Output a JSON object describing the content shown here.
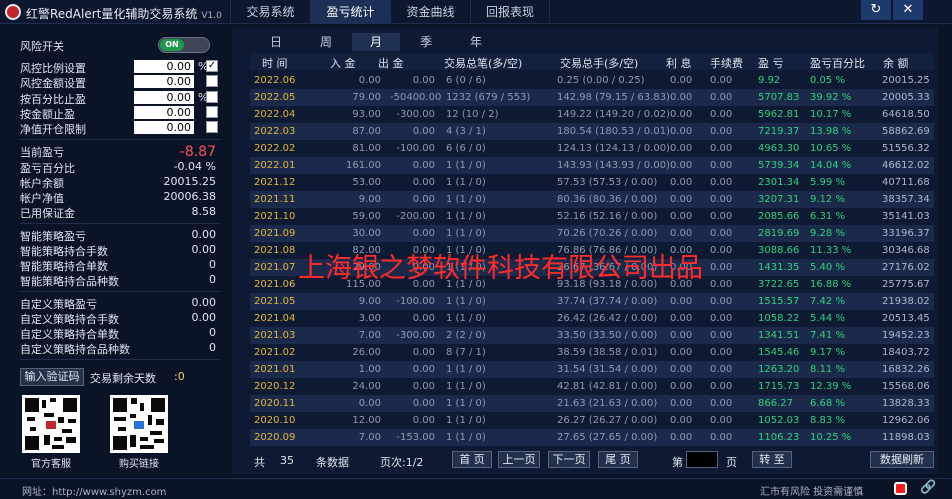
{
  "app": {
    "title": "红警RedAlert量化辅助交易系统",
    "version": "V1.0",
    "tabs": [
      "交易系统",
      "盈亏统计",
      "资金曲线",
      "回报表现"
    ],
    "active_tab": "盈亏统计",
    "refresh_icon": "refresh-icon",
    "close_icon": "close-icon",
    "refresh_glyph": "↻",
    "close_glyph": "✕"
  },
  "risk": {
    "switch_label": "风险开关",
    "switch_state": "ON",
    "settings": [
      {
        "label": "风控比例设置",
        "value": "0.00",
        "unit": "%",
        "checked": true
      },
      {
        "label": "风控金额设置",
        "value": "0.00",
        "unit": "",
        "checked": false
      },
      {
        "label": "按百分比止盈",
        "value": "0.00",
        "unit": "%",
        "checked": false
      },
      {
        "label": "按金额止盈",
        "value": "0.00",
        "unit": "",
        "checked": false
      },
      {
        "label": "净值开仓限制",
        "value": "0.00",
        "unit": "",
        "checked": false
      }
    ],
    "check_glyph": "✓"
  },
  "account": {
    "items": [
      {
        "label": "当前盈亏",
        "value": "-8.87"
      },
      {
        "label": "盈亏百分比",
        "value": "-0.04 %"
      },
      {
        "label": "帐户余额",
        "value": "20015.25"
      },
      {
        "label": "帐户净值",
        "value": "20006.38"
      },
      {
        "label": "已用保证金",
        "value": "8.58"
      }
    ]
  },
  "smart_strategy": {
    "items": [
      {
        "label": "智能策略盈亏",
        "value": "0.00"
      },
      {
        "label": "智能策略持合手数",
        "value": "0.00"
      },
      {
        "label": "智能策略持合单数",
        "value": "0"
      },
      {
        "label": "智能策略持合品种数",
        "value": "0"
      }
    ]
  },
  "custom_strategy": {
    "items": [
      {
        "label": "自定义策略盈亏",
        "value": "0.00"
      },
      {
        "label": "自定义策略持合手数",
        "value": "0.00"
      },
      {
        "label": "自定义策略持合单数",
        "value": "0"
      },
      {
        "label": "自定义策略持合品种数",
        "value": "0"
      }
    ]
  },
  "verify": {
    "button_label": "输入验证码",
    "days_left_label": "交易剩余天数",
    "days_left_value": ":0"
  },
  "qr": {
    "service_caption": "官方客服",
    "purchase_caption": "购买链接"
  },
  "periods": [
    "日",
    "周",
    "月",
    "季",
    "年"
  ],
  "active_period": "月",
  "table": {
    "headers": [
      "时 间",
      "入 金",
      "出 金",
      "交易总笔(多/空)",
      "交易总手(多/空)",
      "利 息",
      "手续费",
      "盈 亏",
      "盈亏百分比",
      "余 额"
    ],
    "rows": [
      [
        "2022.06",
        "0.00",
        "0.00",
        "6  (0 / 6)",
        "0.25  (0.00 / 0.25)",
        "0.00",
        "0.00",
        "9.92",
        "0.05 %",
        "20015.25"
      ],
      [
        "2022.05",
        "79.00",
        "-50400.00",
        "1232  (679 / 553)",
        "142.98  (79.15 / 63.83)",
        "0.00",
        "0.00",
        "5707.83",
        "39.92 %",
        "20005.33"
      ],
      [
        "2022.04",
        "93.00",
        "-300.00",
        "12  (10 / 2)",
        "149.22  (149.20 / 0.02)",
        "0.00",
        "0.00",
        "5962.81",
        "10.17 %",
        "64618.50"
      ],
      [
        "2022.03",
        "87.00",
        "0.00",
        "4  (3 / 1)",
        "180.54  (180.53 / 0.01)",
        "0.00",
        "0.00",
        "7219.37",
        "13.98 %",
        "58862.69"
      ],
      [
        "2022.02",
        "81.00",
        "-100.00",
        "6  (6 / 0)",
        "124.13  (124.13 / 0.00)",
        "0.00",
        "0.00",
        "4963.30",
        "10.65 %",
        "51556.32"
      ],
      [
        "2022.01",
        "161.00",
        "0.00",
        "1  (1 / 0)",
        "143.93  (143.93 / 0.00)",
        "0.00",
        "0.00",
        "5739.34",
        "14.04 %",
        "46612.02"
      ],
      [
        "2021.12",
        "53.00",
        "0.00",
        "1  (1 / 0)",
        "57.53  (57.53 / 0.00)",
        "0.00",
        "0.00",
        "2301.34",
        "5.99 %",
        "40711.68"
      ],
      [
        "2021.11",
        "9.00",
        "0.00",
        "1  (1 / 0)",
        "80.36  (80.36 / 0.00)",
        "0.00",
        "0.00",
        "3207.31",
        "9.12 %",
        "38357.34"
      ],
      [
        "2021.10",
        "59.00",
        "-200.00",
        "1  (1 / 0)",
        "52.16  (52.16 / 0.00)",
        "0.00",
        "0.00",
        "2085.66",
        "6.31 %",
        "35141.03"
      ],
      [
        "2021.09",
        "30.00",
        "0.00",
        "1  (1 / 0)",
        "70.26  (70.26 / 0.00)",
        "0.00",
        "0.00",
        "2819.69",
        "9.28 %",
        "33196.37"
      ],
      [
        "2021.08",
        "82.00",
        "0.00",
        "1  (1 / 0)",
        "76.86  (76.86 / 0.00)",
        "0.00",
        "0.00",
        "3088.66",
        "11.33 %",
        "30346.68"
      ],
      [
        "2021.07",
        "29.00",
        "0.00",
        "1  (1 / 0)",
        "36.67  (36.67 / 0.00)",
        "0.00",
        "0.00",
        "1431.35",
        "5.40 %",
        "27176.02"
      ],
      [
        "2021.06",
        "115.00",
        "0.00",
        "1  (1 / 0)",
        "93.18  (93.18 / 0.00)",
        "0.00",
        "0.00",
        "3722.65",
        "16.88 %",
        "25775.67"
      ],
      [
        "2021.05",
        "9.00",
        "-100.00",
        "1  (1 / 0)",
        "37.74  (37.74 / 0.00)",
        "0.00",
        "0.00",
        "1515.57",
        "7.42 %",
        "21938.02"
      ],
      [
        "2021.04",
        "3.00",
        "0.00",
        "1  (1 / 0)",
        "26.42  (26.42 / 0.00)",
        "0.00",
        "0.00",
        "1058.22",
        "5.44 %",
        "20513.45"
      ],
      [
        "2021.03",
        "7.00",
        "-300.00",
        "2  (2 / 0)",
        "33.50  (33.50 / 0.00)",
        "0.00",
        "0.00",
        "1341.51",
        "7.41 %",
        "19452.23"
      ],
      [
        "2021.02",
        "26.00",
        "0.00",
        "8  (7 / 1)",
        "38.59  (38.58 / 0.01)",
        "0.00",
        "0.00",
        "1545.46",
        "9.17 %",
        "18403.72"
      ],
      [
        "2021.01",
        "1.00",
        "0.00",
        "1  (1 / 0)",
        "31.54  (31.54 / 0.00)",
        "0.00",
        "0.00",
        "1263.20",
        "8.11 %",
        "16832.26"
      ],
      [
        "2020.12",
        "24.00",
        "0.00",
        "1  (1 / 0)",
        "42.81  (42.81 / 0.00)",
        "0.00",
        "0.00",
        "1715.73",
        "12.39 %",
        "15568.06"
      ],
      [
        "2020.11",
        "0.00",
        "0.00",
        "1  (1 / 0)",
        "21.63  (21.63 / 0.00)",
        "0.00",
        "0.00",
        "866.27",
        "6.68 %",
        "13828.33"
      ],
      [
        "2020.10",
        "12.00",
        "0.00",
        "1  (1 / 0)",
        "26.27  (26.27 / 0.00)",
        "0.00",
        "0.00",
        "1052.03",
        "8.83 %",
        "12962.06"
      ],
      [
        "2020.09",
        "7.00",
        "-153.00",
        "1  (1 / 0)",
        "27.65  (27.65 / 0.00)",
        "0.00",
        "0.00",
        "1106.23",
        "10.25 %",
        "11898.03"
      ]
    ]
  },
  "watermark": "上海银之梦软件科技有限公司出品",
  "pager": {
    "total_label": "共",
    "total_value": "35",
    "total_unit": "条数据",
    "page_label": "页次:1/2",
    "first": "首 页",
    "prev": "上一页",
    "next": "下一页",
    "last": "尾 页",
    "goto_prefix": "第",
    "goto_suffix": "页",
    "goto_button": "转 至",
    "refresh_button": "数据刷新"
  },
  "footer": {
    "url": "网址：http://www.shyzm.com",
    "risk_notice": "汇市有风险  投资需谨慎",
    "link_glyph": "🔗"
  },
  "colors": {
    "date": "#e1b73a",
    "positive": "#2fd07b",
    "negative_pnl": "#ff4d5a",
    "watermark": "#ff2a2a"
  }
}
